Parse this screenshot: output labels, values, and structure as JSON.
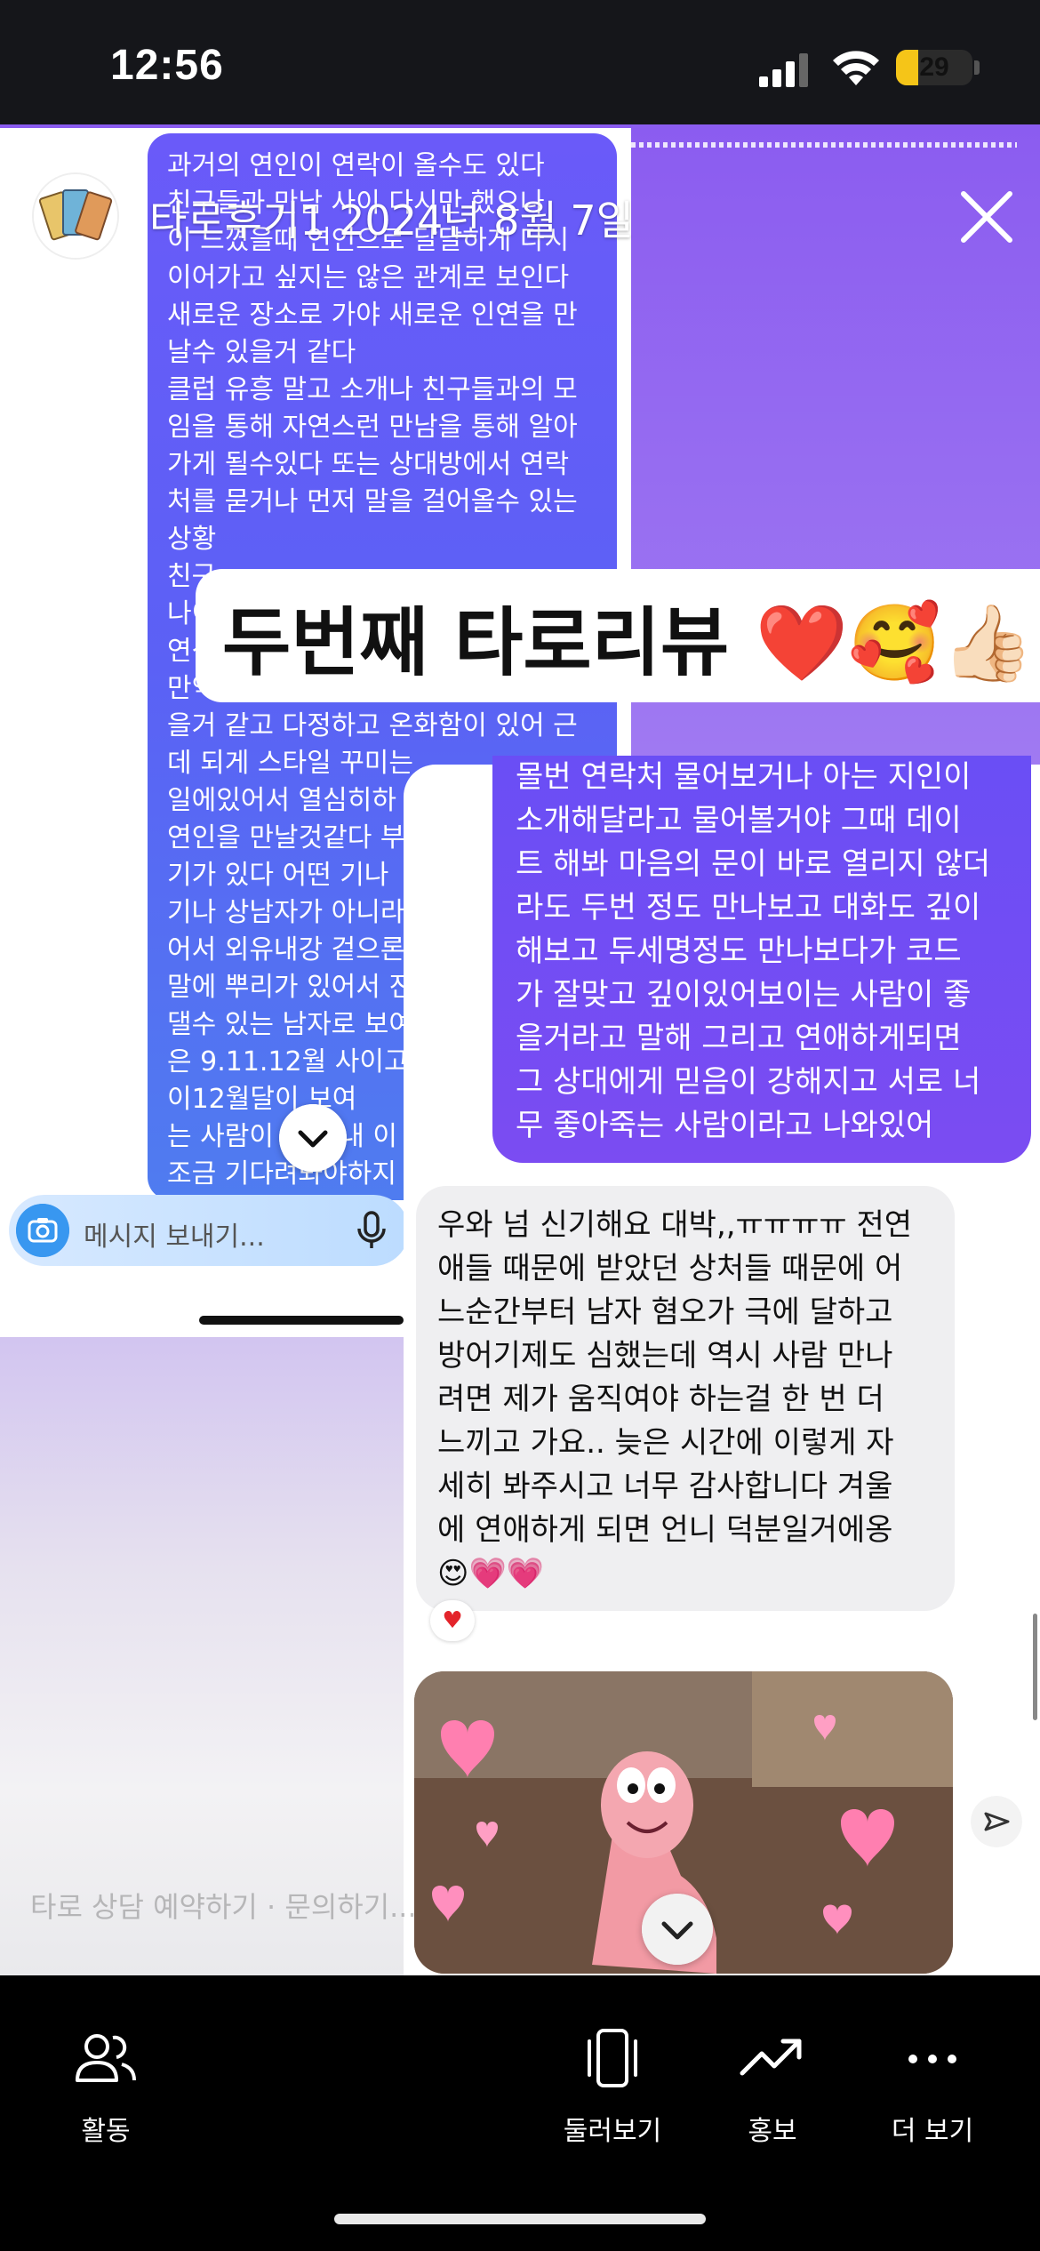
{
  "status_bar": {
    "time": "12:56",
    "battery": 29,
    "battery_label": "29"
  },
  "story": {
    "username": "타로후기1  2024년 8월 7일",
    "headline": "두번째 타로리뷰 ❤️🥰👍🏻",
    "left_message": "과거의 연인이 연락이 올수도 있다\n친구들과 만남 사이 다시만 했으나\n이 느꼈을때 연인으로 달달하게 다시\n이어가고 싶지는 않은 관계로 보인다\n새로운 장소로 가야 새로운 인연을 만\n날수 있을거 같다\n클럽 유흥 말고 소개나 친구들과의 모\n임을 통해 자연스런 만남을 통해 알아\n가게 될수있다 또는 상대방에서 연락\n처를 묻거나 먼저 말을 걸어올수 있는\n상황\n친구\n나이\n연상\n만약 연상이라면 나이차이가 크지않\n을거 같고 다정하고 온화함이 있어 근\n데 되게 스타일 꾸미는\n일에있어서 열심히하\n연인을 만날것같다 부\n기가 있다 어떤 기나\n기나 상남자가 아니라\n어서 외유내강 겉으론\n말에 뿌리가 있어서 진\n댈수 있는 남자로 보여\n은 9.11.12월 사이고\n이12월달이 보여\n는 사람이 없어 내 이\n조금 기다려봐야하지",
    "message_placeholder": "메시지 보내기...",
    "purple_message": "몰번 연락처 물어보거나 아는 지인이\n소개해달라고 물어볼거야 그때 데이\n트 해봐 마음의 문이 바로 열리지 않더\n라도 두번 정도 만나보고 대화도 깊이\n해보고 두세명정도 만나보다가 코드\n가 잘맞고 깊이있어보이는 사람이 좋\n을거라고 말해 그리고 연애하게되면\n그 상대에게 믿음이 강해지고 서로 너\n무 좋아죽는 사람이라고 나와있어",
    "gray_message": "우와 넘 신기해요 대박,,ㅠㅠㅠㅠ 전연\n애들 때문에 받았던 상처들 때문에 어\n느순간부터 남자 혐오가 극에 달하고\n방어기제도 심했는데 역시 사람 만나\n려면 제가 움직여야 하는걸 한 번 더\n느끼고 가요.. 늦은 시간에 이렇게 자\n세히 봐주시고 너무 감사합니다 겨울\n에 연애하게 되면 언니 덕분일거에옹\n😍💗💗",
    "reaction": "♥",
    "ghost_text": "타로 상담 예약하기 · 문의하기..."
  },
  "bottom_nav": [
    {
      "label": "활동",
      "icon": "people-icon"
    },
    {
      "label": "둘러보기",
      "icon": "phone-frame-icon"
    },
    {
      "label": "홍보",
      "icon": "trending-up-icon"
    },
    {
      "label": "더 보기",
      "icon": "more-dots-icon"
    }
  ],
  "colors": {
    "purple": "#6a4ef5",
    "blue_bubble": "#5b61f5",
    "gray_bubble": "#efeff1",
    "accent": "#3897f0"
  }
}
